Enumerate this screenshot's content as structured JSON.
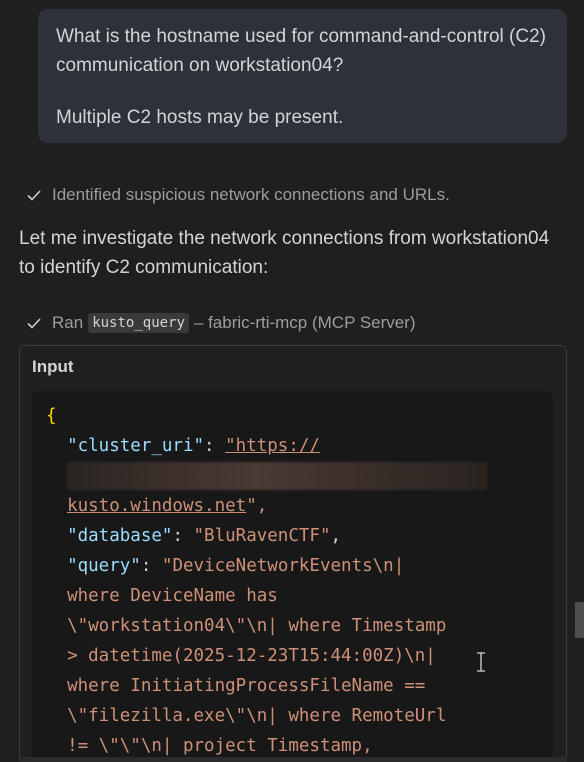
{
  "user_message": {
    "line1": "What is the hostname used for command-and-control (C2) communication on workstation04?",
    "line2": "Multiple C2 hosts may be present."
  },
  "steps": {
    "identified": "Identified suspicious network connections and URLs.",
    "ran_prefix": "Ran",
    "tool_name": "kusto_query",
    "tool_suffix": "– fabric-rti-mcp (MCP Server)"
  },
  "assistant_text": "Let me investigate the network connections from workstation04 to identify C2 communication:",
  "tool_panel": {
    "label": "Input",
    "code": {
      "open_brace": "{",
      "cluster_key": "\"cluster_uri\"",
      "cluster_val_start": "\"https://",
      "cluster_val_end": "kusto.windows.net",
      "cluster_val_close": "\",",
      "database_key": "\"database\"",
      "database_val": "\"BluRavenCTF\"",
      "query_key": "\"query\"",
      "query_lines": [
        "\"DeviceNetworkEvents\\n|",
        "where DeviceName has",
        "\\\"workstation04\\\"\\n| where Timestamp",
        "> datetime(2025-12-23T15:44:00Z)\\n|",
        "where InitiatingProcessFileName ==",
        "\\\"filezilla.exe\\\"\\n| where RemoteUrl",
        "!= \\\"\\\"\\n| project Timestamp,"
      ]
    }
  },
  "colors": {
    "background": "#1f1f1f",
    "bubble": "#2c313a",
    "code_bg": "#181818",
    "key": "#9cdcfe",
    "string": "#ce9178",
    "brace": "#ffd700"
  },
  "icons": {
    "step_check": "check-icon",
    "cursor": "text-cursor-icon"
  }
}
